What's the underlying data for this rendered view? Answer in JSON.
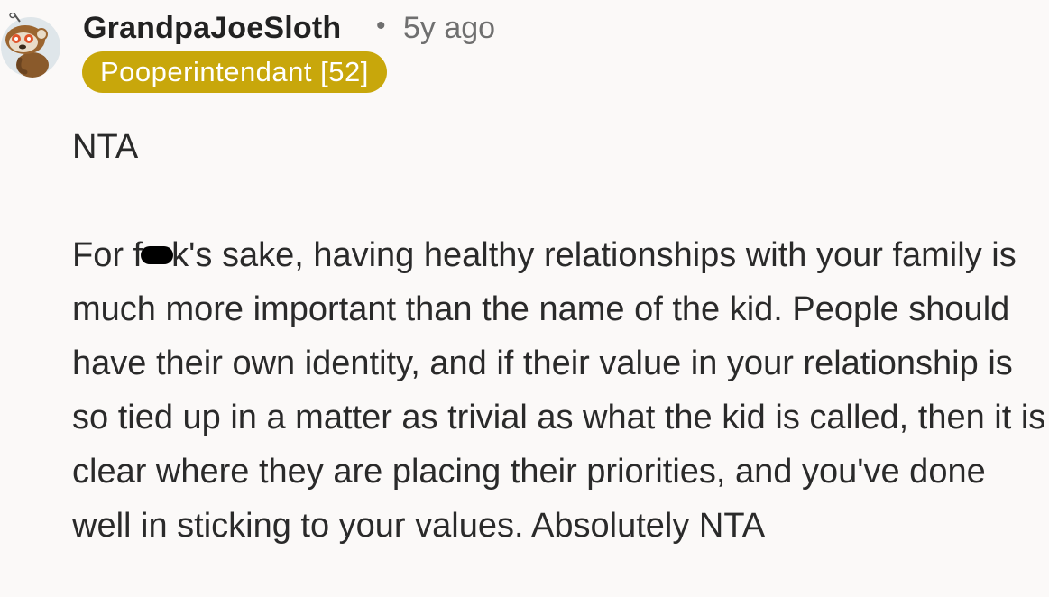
{
  "comment": {
    "author": "GrandpaJoeSloth",
    "separator": "•",
    "timestamp": "5y ago",
    "flair": "Pooperintendant [52]",
    "body": {
      "line1": "NTA",
      "para2_prefix": "For f",
      "para2_suffix": "k's sake, having healthy relationships with your family is much more important than the name of the kid. People should have their own identity, and if their value in your relationship is so tied up in a matter as trivial as what the kid is called, then it is clear where they are placing their priorities, and you've done well in sticking to your values. Absolutely NTA"
    }
  },
  "colors": {
    "background": "#fbf9f8",
    "flair_bg": "#c8a70b",
    "flair_text": "#ffffff",
    "meta_text": "#6f6f6f"
  },
  "icons": {
    "avatar": "sloth-avatar-icon",
    "censor": "censor-bar"
  }
}
